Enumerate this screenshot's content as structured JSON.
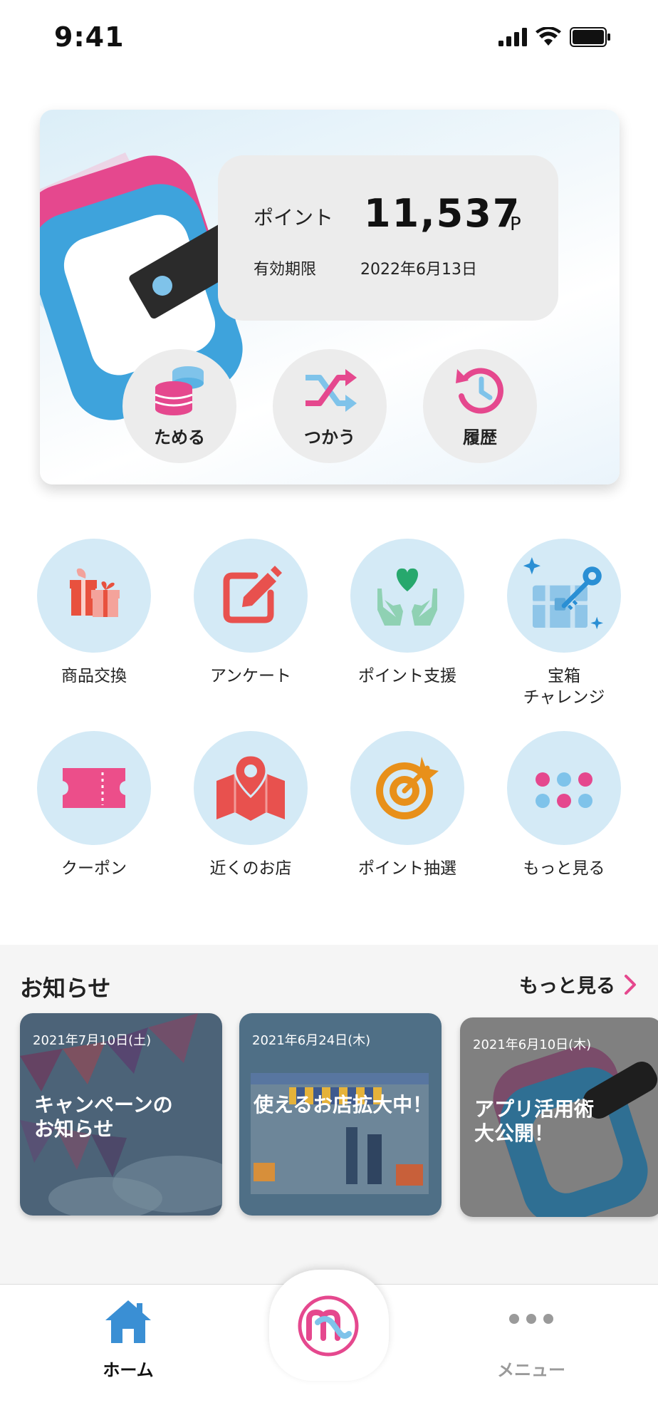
{
  "status_bar": {
    "time": "9:41"
  },
  "point_card": {
    "points_label": "ポイント",
    "points_value": "11,537",
    "points_unit": "P",
    "expiry_label": "有効期限",
    "expiry_value": "2022年6月13日",
    "actions": [
      {
        "label": "ためる",
        "icon": "coin-stack-icon"
      },
      {
        "label": "つかう",
        "icon": "shuffle-icon"
      },
      {
        "label": "履歴",
        "icon": "history-icon"
      }
    ]
  },
  "menu": [
    {
      "label": "商品交換",
      "icon": "gift-icon"
    },
    {
      "label": "アンケート",
      "icon": "edit-icon"
    },
    {
      "label": "ポイント支援",
      "icon": "heart-hands-icon"
    },
    {
      "label": "宝箱\nチャレンジ",
      "icon": "treasure-chest-icon"
    },
    {
      "label": "クーポン",
      "icon": "ticket-icon"
    },
    {
      "label": "近くのお店",
      "icon": "map-pin-icon"
    },
    {
      "label": "ポイント抽選",
      "icon": "target-icon"
    },
    {
      "label": "もっと見る",
      "icon": "dots-grid-icon"
    }
  ],
  "news": {
    "title": "お知らせ",
    "more_label": "もっと見る",
    "items": [
      {
        "date": "2021年7月10日(土)",
        "headline": "キャンペーンの\nお知らせ"
      },
      {
        "date": "2021年6月24日(木)",
        "headline": "使えるお店拡大中！"
      },
      {
        "date": "2021年6月10日(木)",
        "headline": "アプリ活用術\n大公開！"
      }
    ]
  },
  "tabbar": {
    "home_label": "ホーム",
    "menu_label": "メニュー"
  },
  "colors": {
    "pink": "#e5488e",
    "blue": "#3ea3dc",
    "light_blue_circle": "#d4eaf6",
    "home_active": "#3a8fd4"
  }
}
